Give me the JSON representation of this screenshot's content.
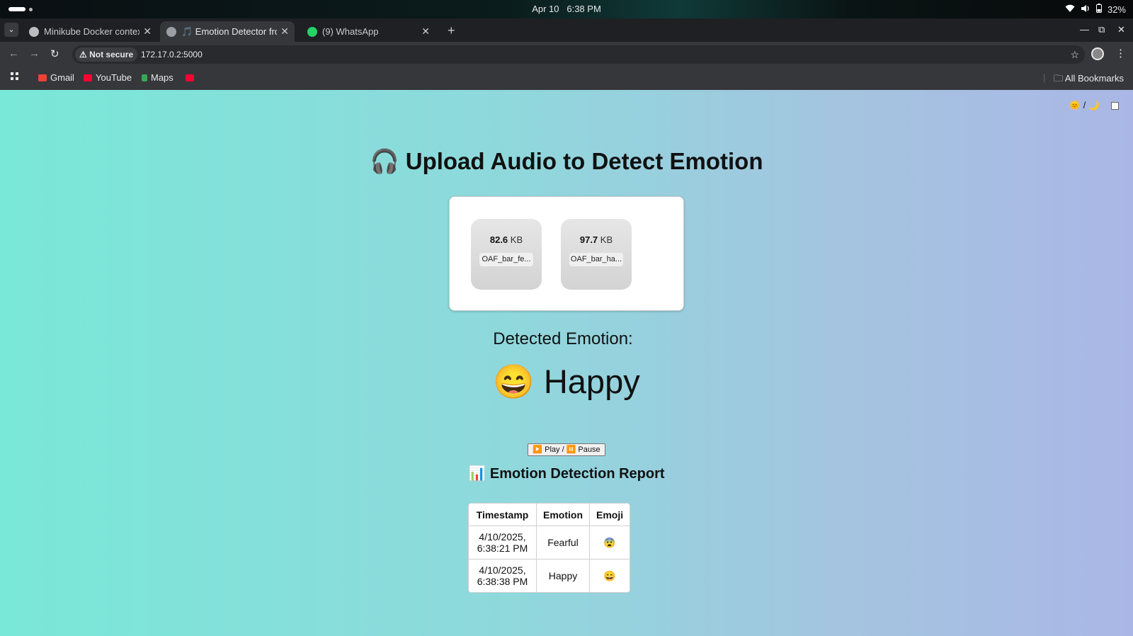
{
  "system_bar": {
    "date": "Apr 10",
    "time": "6:38 PM",
    "battery": "32%"
  },
  "browser": {
    "tabs": [
      {
        "title": "Minikube Docker context",
        "active": false,
        "favicon_color": "#bdbdbd"
      },
      {
        "title": "🎵 Emotion Detector from",
        "active": true,
        "favicon_color": "#9aa0a6"
      },
      {
        "title": "(9) WhatsApp",
        "active": false,
        "favicon_color": "#25d366"
      }
    ],
    "new_tab": "+",
    "security_label": "Not secure",
    "url": "172.17.0.2:5000",
    "bookmarks": [
      {
        "label": "Gmail",
        "icon_color": "#ea4335"
      },
      {
        "label": "YouTube",
        "icon_color": "#ff0033"
      },
      {
        "label": "Maps",
        "icon_color": "#34a853"
      },
      {
        "label": "",
        "icon_color": "#ff0033"
      }
    ],
    "all_bookmarks": "All Bookmarks"
  },
  "page": {
    "theme_toggle": "🌞 / 🌙",
    "heading": "🎧 Upload Audio to Detect Emotion",
    "files": [
      {
        "size_value": "82.6",
        "size_unit": "KB",
        "name": "OAF_bar_fe..."
      },
      {
        "size_value": "97.7",
        "size_unit": "KB",
        "name": "OAF_bar_ha..."
      }
    ],
    "detected_label": "Detected Emotion:",
    "detected_value": "😄 Happy",
    "play_button": "▶️ Play / ⏸️ Pause",
    "report_title": "📊 Emotion Detection Report",
    "table": {
      "headers": [
        "Timestamp",
        "Emotion",
        "Emoji"
      ],
      "rows": [
        {
          "ts_date": "4/10/2025,",
          "ts_time": "6:38:21 PM",
          "emotion": "Fearful",
          "emoji": "😨"
        },
        {
          "ts_date": "4/10/2025,",
          "ts_time": "6:38:38 PM",
          "emotion": "Happy",
          "emoji": "😄"
        }
      ]
    }
  }
}
